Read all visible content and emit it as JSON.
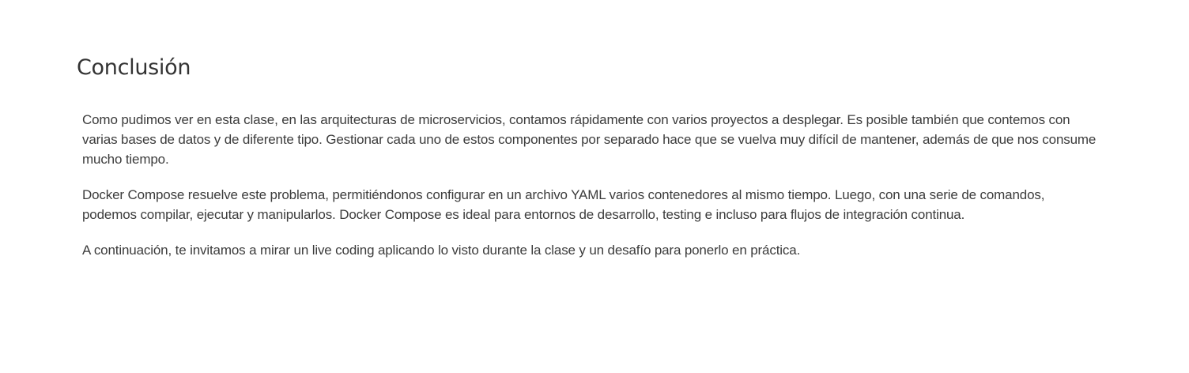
{
  "heading": {
    "title": "Conclusión"
  },
  "paragraphs": [
    {
      "text": "Como pudimos ver en esta clase, en las arquitecturas de microservicios, contamos rápidamente con varios proyectos a desplegar. Es posible también que contemos con varias bases de datos y de diferente tipo. Gestionar cada uno de estos componentes por separado hace que se vuelva muy difícil de mantener, además de que nos consume mucho tiempo."
    },
    {
      "text": "Docker Compose resuelve este problema, permitiéndonos configurar en un archivo YAML varios contenedores al mismo tiempo. Luego, con una serie de comandos, podemos compilar, ejecutar y manipularlos. Docker Compose es ideal para entornos de desarrollo, testing e incluso para flujos de integración continua."
    },
    {
      "text": "A continuación, te invitamos a mirar un live coding aplicando lo visto durante la clase y un desafío para ponerlo en práctica."
    }
  ]
}
